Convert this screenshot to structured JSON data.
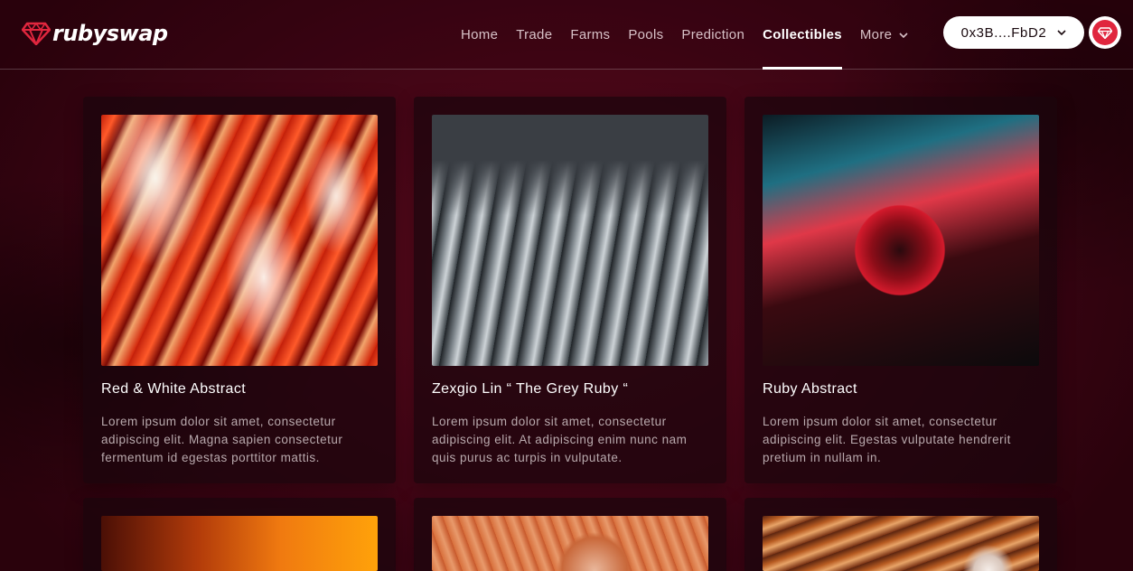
{
  "brand": {
    "name": "rubyswap",
    "accent": "#e0263e"
  },
  "nav": {
    "items": [
      {
        "label": "Home"
      },
      {
        "label": "Trade"
      },
      {
        "label": "Farms"
      },
      {
        "label": "Pools"
      },
      {
        "label": "Prediction"
      },
      {
        "label": "Collectibles",
        "active": true
      },
      {
        "label": "More",
        "icon": "chevron-down-icon"
      }
    ]
  },
  "wallet": {
    "address": "0x3B....FbD2",
    "icon": "chevron-down-icon"
  },
  "avatar": {
    "icon": "ruby-gem-icon"
  },
  "collectibles": [
    {
      "title": "Red & White Abstract",
      "description": "Lorem ipsum dolor sit amet, consectetur adipiscing elit. Magna sapien consectetur fermentum id egestas porttitor mattis."
    },
    {
      "title": "Zexgio Lin “ The Grey Ruby “",
      "description": "Lorem ipsum dolor sit amet, consectetur adipiscing elit. At adipiscing enim nunc nam quis purus ac turpis in vulputate."
    },
    {
      "title": "Ruby Abstract",
      "description": "Lorem ipsum dolor sit amet, consectetur adipiscing elit. Egestas vulputate hendrerit pretium in nullam in."
    }
  ]
}
